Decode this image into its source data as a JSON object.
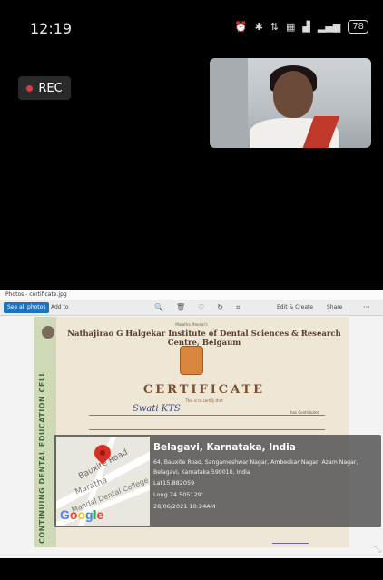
{
  "status_bar": {
    "time": "12:19",
    "icons": [
      "alarm-icon",
      "bluetooth-icon",
      "data-icon",
      "volte-icon",
      "signal-4g-icon",
      "signal-icon"
    ],
    "battery": "78"
  },
  "call": {
    "rec_label": "REC",
    "rec_color": "#e53935"
  },
  "photos_app": {
    "window_title": "Photos - certificate.jpg",
    "see_all_label": "See all photos",
    "add_to_label": "Add to",
    "edit_create_label": "Edit & Create",
    "share_label": "Share",
    "more_label": "···"
  },
  "certificate": {
    "side_band": "CONTINUING DENTAL EDUCATION CELL",
    "society": "Maratha Mandal's",
    "institution": "Nathajirao G Halgekar Institute of Dental Sciences & Research Centre, Belgaum",
    "title": "CERTIFICATE",
    "this_is": "This is to certify that",
    "name": "Swati KTS",
    "contributed": "has Contributed"
  },
  "geotag": {
    "city": "Belagavi, Karnataka, India",
    "address": "64, Bauxite Road, Sangameshwar Nagar, Ambedkar Nagar, Azam Nagar, Belagavi, Karnataka 590010, India",
    "lat": "Lat15.882059",
    "long": "Long 74.505129'",
    "datetime": "28/06/2021 10:24AM",
    "map_road": "Bauxite Road",
    "map_place": "Maratha",
    "map_college": "Mandal Dental College",
    "brand": [
      "G",
      "o",
      "o",
      "g",
      "l",
      "e"
    ]
  }
}
